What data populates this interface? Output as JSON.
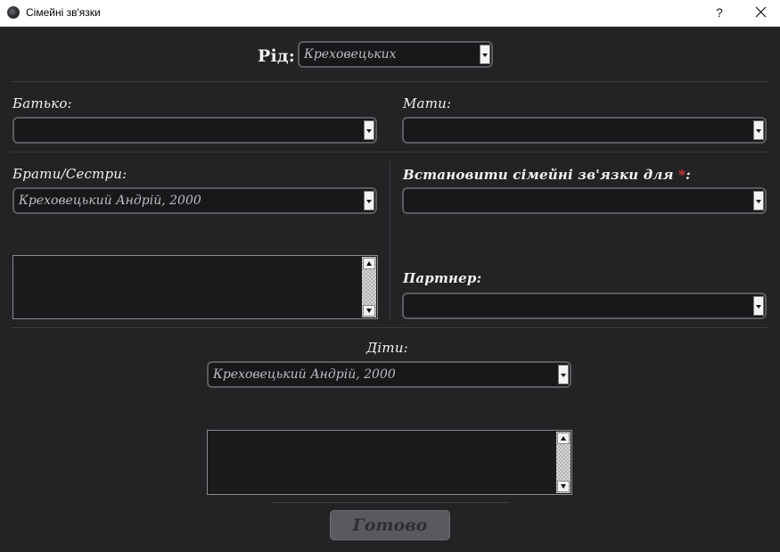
{
  "window": {
    "title": "Сімейні зв'язки",
    "help_label": "?"
  },
  "clan": {
    "label": "Рід:",
    "value": "Креховецьких"
  },
  "father": {
    "label": "Батько:",
    "value": ""
  },
  "mother": {
    "label": "Мати:",
    "value": ""
  },
  "siblings": {
    "label": "Брати/Сестри:",
    "value": "Креховецький Андрій, 2000",
    "list_items": []
  },
  "target_person": {
    "label": "Встановити сімейні зв'язки для",
    "required_mark": "*",
    "suffix": ":",
    "value": ""
  },
  "partner": {
    "label": "Партнер:",
    "value": ""
  },
  "children": {
    "label": "Діти:",
    "value": "Креховецький Андрій, 2000",
    "list_items": []
  },
  "actions": {
    "done_label": "Готово"
  },
  "icons": {
    "app": "app-icon",
    "close": "close-icon",
    "dropdown": "chevron-down-icon",
    "scroll_up": "scroll-up-icon",
    "scroll_down": "scroll-down-icon"
  },
  "colors": {
    "background": "#232326",
    "field_background": "#18181b",
    "label_text": "#f2f2f2",
    "field_text": "#bdbdc2",
    "required_mark": "#e03a3a",
    "button_background": "#5a5a5e",
    "titlebar": "#ffffff"
  }
}
